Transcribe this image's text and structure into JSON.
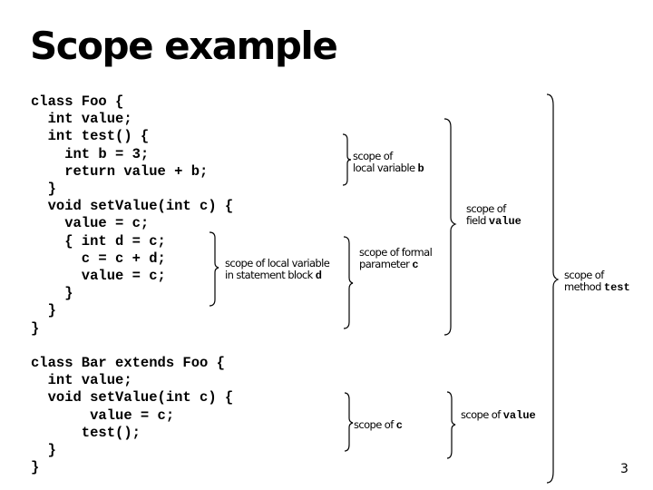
{
  "slide": {
    "title": "Scope example",
    "page_number": "3"
  },
  "code": {
    "foo_lines": [
      "class Foo {",
      "  int value;",
      "  int test() {",
      "    int b = 3;",
      "    return value + b;",
      "  }",
      "  void setValue(int c) {",
      "    value = c;",
      "    { int d = c;",
      "      c = c + d;",
      "      value = c;",
      "    }",
      "  }",
      "}"
    ],
    "bar_lines": [
      "class Bar extends Foo {",
      "  int value;",
      "  void setValue(int c) {",
      "       value = c;",
      "      test();",
      "  }",
      "}"
    ]
  },
  "annotations": {
    "local_b": {
      "line1": "scope of",
      "line2_text": "local variable ",
      "line2_code": "b"
    },
    "block_d": {
      "line1": "scope of local variable",
      "line2_text": "in statement block ",
      "line2_code": "d"
    },
    "param_c": {
      "line1": "scope of formal",
      "line2_text": "parameter ",
      "line2_code": "c"
    },
    "field_value": {
      "line1": "scope of",
      "line2_text": "field ",
      "line2_code": "value"
    },
    "method_test": {
      "line1": "scope of",
      "line2_text": "method ",
      "line2_code": "test"
    },
    "bar_c": {
      "text": "scope of ",
      "code": "c"
    },
    "bar_value": {
      "text": "scope of ",
      "code": "value"
    }
  }
}
